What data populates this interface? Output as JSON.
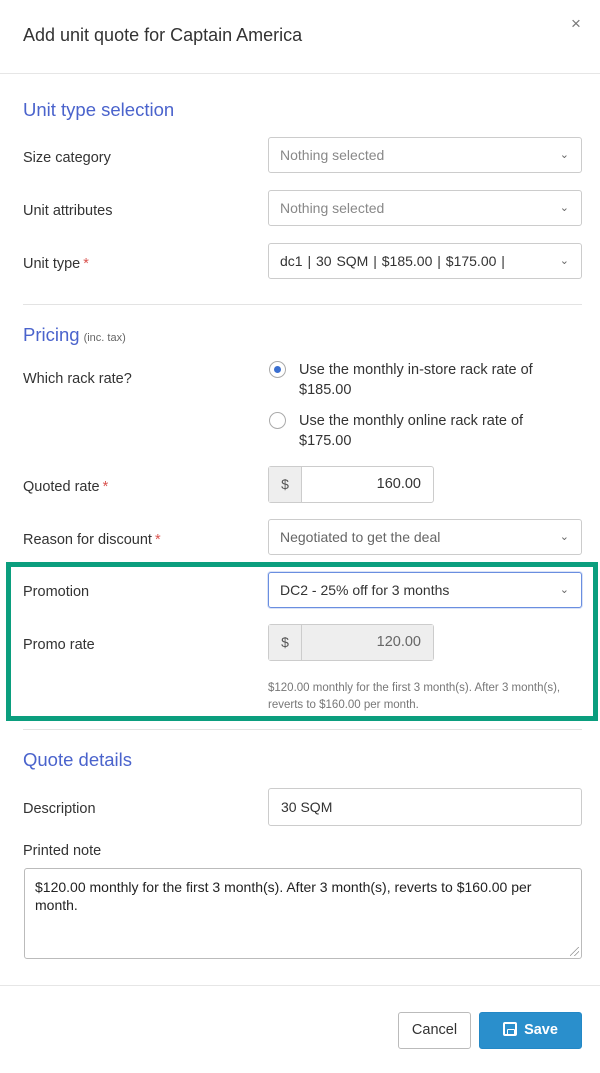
{
  "modal": {
    "title": "Add unit quote for Captain America",
    "close_label": "×"
  },
  "unit_type_section": {
    "title": "Unit type selection",
    "size_category": {
      "label": "Size category",
      "value": "Nothing selected"
    },
    "unit_attributes": {
      "label": "Unit attributes",
      "value": "Nothing selected"
    },
    "unit_type": {
      "label": "Unit type",
      "required_mark": "*",
      "value": "dc1  |  30 SQM  |  $185.00  |  $175.00  |"
    }
  },
  "pricing_section": {
    "title": "Pricing",
    "subtitle": "(inc. tax)",
    "rack_rate": {
      "label": "Which rack rate?",
      "options": [
        {
          "label": "Use the monthly in-store rack rate of $185.00",
          "checked": true
        },
        {
          "label": "Use the monthly online rack rate of $175.00",
          "checked": false
        }
      ]
    },
    "quoted_rate": {
      "label": "Quoted rate",
      "required_mark": "*",
      "currency": "$",
      "value": "160.00"
    },
    "discount_reason": {
      "label": "Reason for discount",
      "required_mark": "*",
      "value": "Negotiated to get the deal"
    },
    "promotion": {
      "label": "Promotion",
      "value": "DC2 - 25% off for 3 months"
    },
    "promo_rate": {
      "label": "Promo rate",
      "currency": "$",
      "value": "120.00",
      "help": "$120.00 monthly for the first 3 month(s). After 3 month(s), reverts to $160.00 per month."
    }
  },
  "quote_details_section": {
    "title": "Quote details",
    "description": {
      "label": "Description",
      "value": "30 SQM"
    },
    "printed_note": {
      "label": "Printed note",
      "value": "$120.00 monthly for the first 3 month(s). After 3 month(s), reverts to $160.00 per month."
    }
  },
  "footer": {
    "cancel_label": "Cancel",
    "save_label": "Save"
  },
  "colors": {
    "section_title": "#4a63cc",
    "highlight_border": "#0b9e7e",
    "primary_button": "#2a8fcc",
    "required": "#d9534f"
  },
  "icons": {
    "close": "close-icon",
    "dropdown": "chevron-down-icon",
    "save": "save-icon"
  }
}
